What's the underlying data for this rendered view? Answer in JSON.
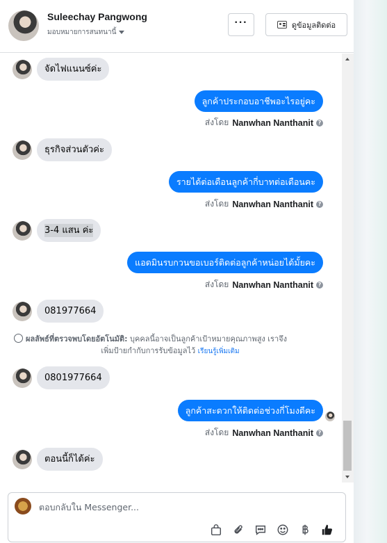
{
  "header": {
    "name": "Suleechay Pangwong",
    "assign_label": "มอบหมายการสนทนานี้",
    "more_label": "···",
    "contact_button_label": "ดูข้อมูลติดต่อ"
  },
  "messages": {
    "m1": "จัดไฟแนนซ์ค่ะ",
    "m2": "ลูกค้าประกอบอาชีพอะไรอยู่คะ",
    "m3": "ธุรกิจส่วนตัวค่ะ",
    "m4": "รายได้ต่อเดือนลูกค้ากี่บาทต่อเดือนคะ",
    "m5": "3-4 แสน ค่ะ",
    "m6": "แอดมินรบกวนขอเบอร์ติดต่อลูกค้าหน่อยได้มั้ยคะ",
    "m7": "081977664",
    "m8": "0801977664",
    "m9": "ลูกค้าสะดวกให้ติดต่อช่วงกี่โมงดีคะ",
    "m10": "ตอนนี้ก็ได้ค่ะ"
  },
  "sent_by": {
    "prefix": "ส่งโดย",
    "agent": "Nanwhan Nanthanit",
    "help": "?"
  },
  "auto_detect": {
    "label": "ผลลัพธ์ที่ตรวจพบโดยอัตโนมัติ:",
    "text1": "บุคคลนี้อาจเป็นลูกค้าเป้าหมายคุณภาพสูง เราจึง",
    "text2": "เพิ่มป้ายกำกับการรับข้อมูลไว้",
    "link": "เรียนรู้เพิ่มเติม"
  },
  "composer": {
    "placeholder": "ตอบกลับใน Messenger..."
  },
  "icons": [
    "more-icon",
    "contact-card-icon",
    "bag-icon",
    "attach-icon",
    "saved-replies-icon",
    "emoji-icon",
    "baht-icon",
    "like-icon"
  ],
  "colors": {
    "accent": "#0a7cff",
    "incoming_bubble": "#e4e6eb"
  }
}
